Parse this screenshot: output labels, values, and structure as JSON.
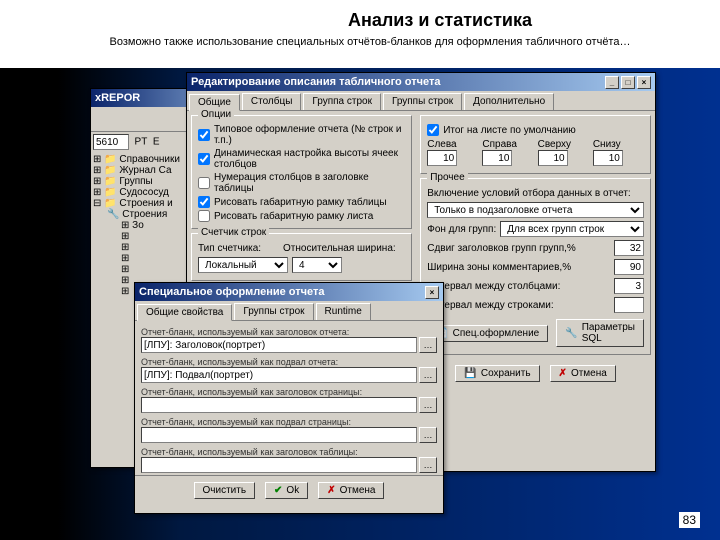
{
  "slide": {
    "title": "Анализ и статистика",
    "subtitle": "Возможно также использование специальных отчётов-бланков для оформления табличного отчёта…",
    "page": "83"
  },
  "win_back": {
    "title": "xREPOR"
  },
  "win_editor": {
    "title": "Редактирование описания табличного отчета",
    "tabs": [
      "Общие",
      "Столбцы",
      "Группа строк",
      "Группы строк",
      "Дополнительно"
    ],
    "options_group": "Опции",
    "opt1": "Типовое оформление отчета (№ строк и т.п.)",
    "opt2": "Динамическая настройка высоты ячеек столбцов",
    "opt3": "Нумерация столбцов в заголовке таблицы",
    "opt4": "Рисовать габаритную рамку таблицы",
    "opt5": "Рисовать габаритную рамку листа",
    "chk_default": "Итог на листе по умолчанию",
    "lbl_sleva": "Слева",
    "lbl_sprava": "Справа",
    "lbl_sverhu": "Сверху",
    "lbl_snizu": "Снизу",
    "v_sleva": "10",
    "v_sprava": "10",
    "v_sverhu": "10",
    "v_snizu": "10",
    "prochee": "Прочее",
    "incl_label": "Включение условий отбора данных в отчет:",
    "incl_val": "Только в подзаголовке отчета",
    "fon_label": "Фон для групп:",
    "fon_val": "Для всех групп строк",
    "sdvig_label": "Сдвиг заголовков групп групп,%",
    "sdvig_val": "32",
    "shir_label": "Ширина зоны комментариев,%",
    "shir_val": "90",
    "intcol_label": "Интервал между столбцами:",
    "intcol_val": "3",
    "introw_label": "Интервал между строками:",
    "btn_spec": "Спец.оформление",
    "btn_sql": "Параметры SQL",
    "btn_save": "Сохранить",
    "btn_cancel": "Отмена",
    "counter_group": "Счетчик строк",
    "counter_type_lbl": "Тип счетчика:",
    "counter_type": "Локальный",
    "counter_width_lbl": "Относительная ширина:",
    "counter_width": "4"
  },
  "win_spec": {
    "title": "Специальное оформление отчета",
    "tabs": [
      "Общие свойства",
      "Группы строк",
      "Runtime"
    ],
    "f1_lbl": "Отчет-бланк, используемый как заголовок отчета:",
    "f1_val": "[ЛПУ]: Заголовок(портрет)",
    "f2_lbl": "Отчет-бланк, используемый как подвал отчета:",
    "f2_val": "[ЛПУ]: Подвал(портрет)",
    "f3_lbl": "Отчет-бланк, используемый как заголовок страницы:",
    "f4_lbl": "Отчет-бланк, используемый как подвал страницы:",
    "f5_lbl": "Отчет-бланк, используемый как заголовок таблицы:",
    "btn_clear": "Очистить",
    "btn_ok": "Ok",
    "btn_cancel": "Отмена"
  },
  "tree": {
    "i1": "Справочники",
    "i2": "Журнал Са",
    "i3": "Группы",
    "i4": "Судососуд",
    "i5": "Строения и",
    "i6": "Строения",
    "i7": "Зо"
  }
}
